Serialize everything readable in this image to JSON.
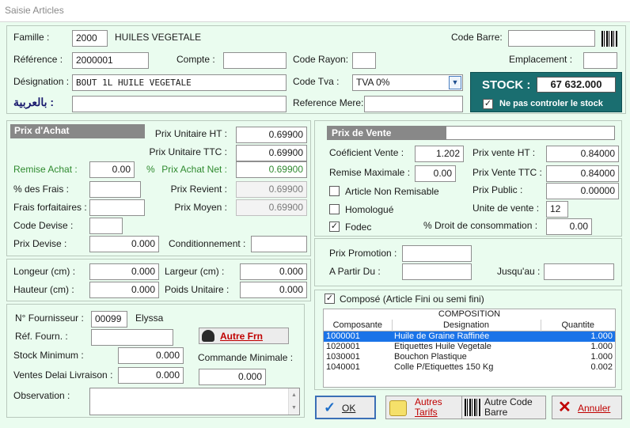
{
  "window": {
    "title": "Saisie Articles"
  },
  "labels": {
    "famille": "Famille :",
    "reference": "Référence :",
    "designation": "Désignation :",
    "arabic": "بالعربية :",
    "compte": "Compte :",
    "code_rayon": "Code Rayon:",
    "code_tva": "Code Tva :",
    "reference_mere": "Reference Mere:",
    "code_barre": "Code Barre:",
    "emplacement": "Emplacement :",
    "stock": "STOCK :",
    "ne_pas_controler": "Ne pas controler le stock",
    "prix_achat_title": "Prix d'Achat",
    "prix_unitaire_ht": "Prix Unitaire HT :",
    "prix_unitaire_ttc": "Prix Unitaire TTC :",
    "remise_achat": "Remise Achat :",
    "percent": "%",
    "prix_achat_net": "Prix Achat Net :",
    "pct_frais": "% des Frais :",
    "prix_revient": "Prix Revient :",
    "frais_forfaitaires": "Frais forfaitaires :",
    "prix_moyen": "Prix Moyen :",
    "code_devise": "Code Devise :",
    "prix_devise": "Prix Devise :",
    "conditionnement": "Conditionnement :",
    "longeur": "Longeur (cm) :",
    "largeur": "Largeur (cm) :",
    "hauteur": "Hauteur  (cm) :",
    "poids_unitaire": "Poids Unitaire :",
    "n_fournisseur": "N° Fournisseur :",
    "ref_fourn": "Réf. Fourn. :",
    "stock_minimum": "Stock Minimum :",
    "commande_minimale": "Commande Minimale :",
    "ventes_delai": "Ventes Delai Livraison :",
    "observation": "Observation :",
    "prix_vente_title": "Prix de Vente",
    "coeficient_vente": "Coéficient  Vente :",
    "prix_vente_ht": "Prix vente HT :",
    "remise_maximale": "Remise Maximale :",
    "prix_vente_ttc": "Prix  Vente TTC :",
    "article_non_remisable": "Article Non Remisable",
    "prix_public": "Prix Public :",
    "homologue": "Homologué",
    "unite_vente": "Unite de vente :",
    "fodec": "Fodec",
    "droit_consommation": "% Droit de consommation :",
    "prix_promotion": "Prix Promotion :",
    "a_partir_du": "A Partir Du :",
    "jusquau": "Jusqu'au :",
    "compose": "Composé (Article Fini ou semi fini)",
    "composition": "COMPOSITION"
  },
  "values": {
    "famille_code": "2000",
    "famille_name": "HUILES VEGETALE",
    "reference": "2000001",
    "designation": "BOUT 1L HUILE VEGETALE",
    "code_tva": "TVA 0%",
    "stock": "67 632.000",
    "prix_unitaire_ht": "0.69900",
    "prix_unitaire_ttc": "0.69900",
    "remise_achat": "0.00",
    "prix_achat_net": "0.69900",
    "prix_revient": "0.69900",
    "prix_moyen": "0.69900",
    "prix_devise": "0.000",
    "longeur": "0.000",
    "largeur": "0.000",
    "hauteur": "0.000",
    "poids_unitaire": "0.000",
    "n_fournisseur": "00099",
    "fournisseur_name": "Elyssa",
    "stock_minimum": "0.000",
    "ventes_delai": "0.000",
    "commande_minimale": "0.000",
    "coeficient_vente": "1.202",
    "prix_vente_ht": "0.84000",
    "remise_maximale": "0.00",
    "prix_vente_ttc": "0.84000",
    "prix_public": "0.00000",
    "unite_vente": "12",
    "droit_consommation": "0.00"
  },
  "checks": {
    "ne_pas_controler": true,
    "article_non_remisable": false,
    "homologue": false,
    "fodec": true,
    "compose": true
  },
  "buttons": {
    "autre_frn": "Autre Frn",
    "ok": "OK",
    "autres_tarifs_1": "Autres",
    "autres_tarifs_2": "Tarifs",
    "autre_code_1": "Autre Code",
    "autre_code_2": "Barre",
    "annuler": "Annuler"
  },
  "composition": {
    "columns": [
      "Composante",
      "Designation",
      "Quantite"
    ],
    "rows": [
      [
        "1000001",
        "Huile de Graine Raffinée",
        "1.000"
      ],
      [
        "1020001",
        "Etiquettes Huile Vegetale",
        "1.000"
      ],
      [
        "1030001",
        "Bouchon Plastique",
        "1.000"
      ],
      [
        "1040001",
        "Colle P/Etiquettes 150 Kg",
        "0.002"
      ]
    ]
  },
  "colors": {
    "window_bg": "#eafcef",
    "stock_panel": "#1a6e70",
    "selection": "#1a73e8",
    "section_header": "#888888"
  }
}
